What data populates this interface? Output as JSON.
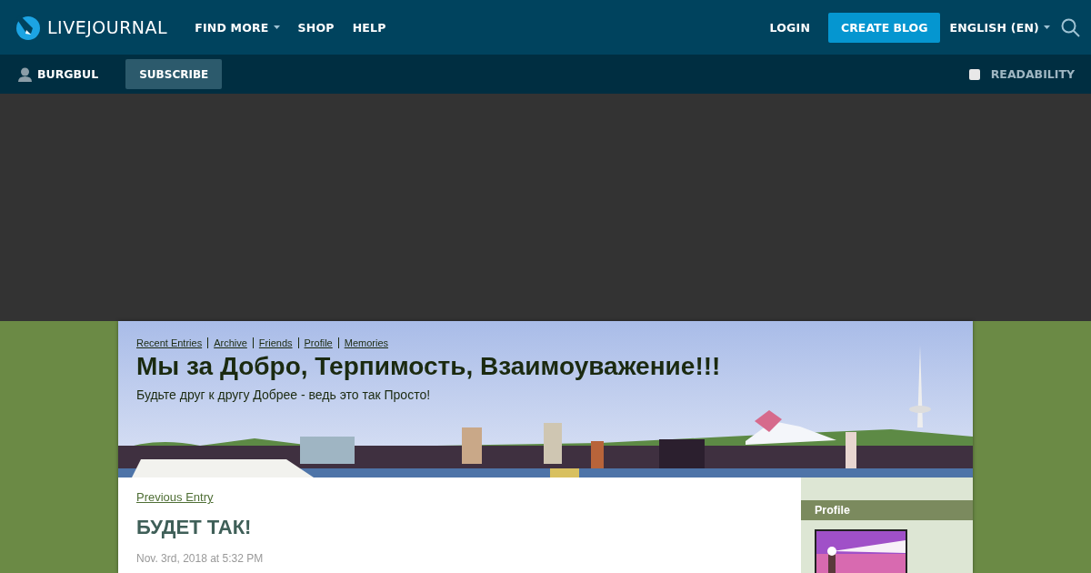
{
  "top_nav": {
    "logo": "LIVEJOURNAL",
    "menu": [
      {
        "label": "FIND MORE",
        "dropdown": true
      },
      {
        "label": "SHOP",
        "dropdown": false
      },
      {
        "label": "HELP",
        "dropdown": false
      }
    ],
    "login": "LOGIN",
    "create_blog": "CREATE BLOG",
    "language": "ENGLISH (EN)"
  },
  "user_bar": {
    "username": "BURGBUL",
    "subscribe": "SUBSCRIBE",
    "readability": {
      "label": "READABILITY",
      "checked": false
    }
  },
  "journal": {
    "nav_links": [
      "Recent Entries",
      "Archive",
      "Friends",
      "Profile",
      "Memories"
    ],
    "title": "Мы за Добро, Терпимость, Взаимоуважение!!!",
    "subtitle": "Будьте друг к другу Добрее - ведь это так Просто!"
  },
  "entry": {
    "previous": "Previous Entry",
    "title": "БУДЕТ ТАК!",
    "date": "Nov. 3rd, 2018 at 5:32 PM"
  },
  "sidebar": {
    "heading": "Profile"
  }
}
